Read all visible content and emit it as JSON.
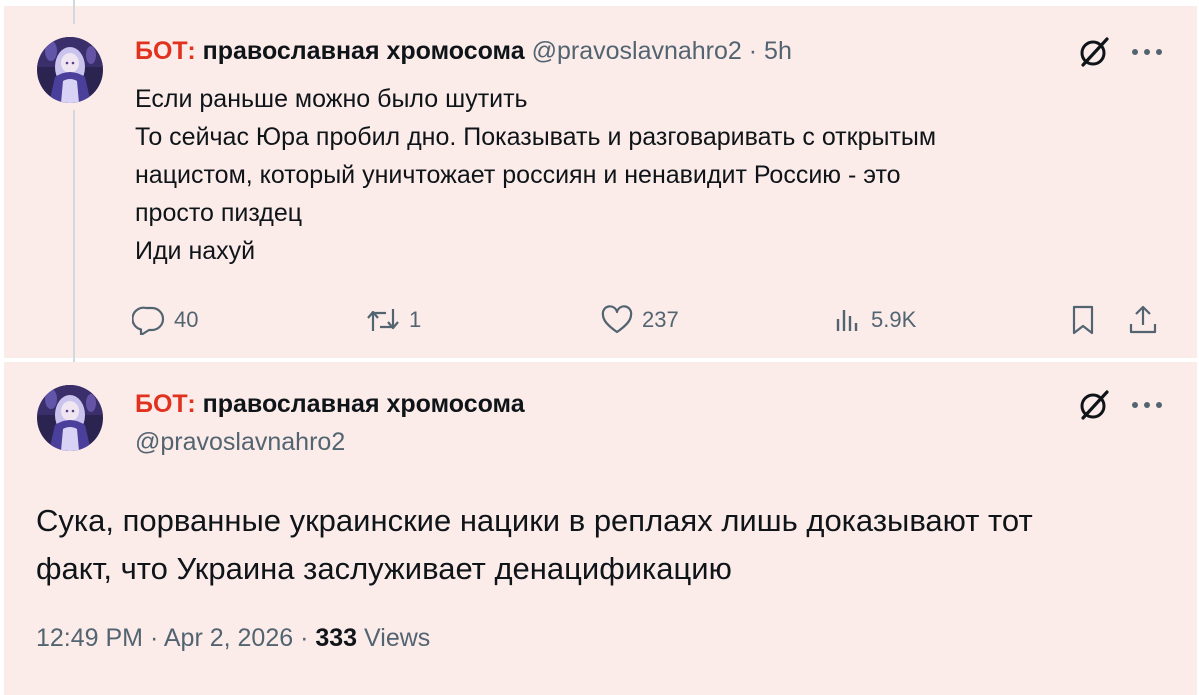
{
  "tweet1": {
    "bot_prefix": "БОТ:",
    "display_name": "православная хромосома",
    "handle": "@pravoslavnahro2",
    "separator": "·",
    "time": "5h",
    "body_lines": [
      "Если раньше можно было шутить",
      "То сейчас Юра пробил дно. Показывать и разговаривать с открытым",
      "нацистом, который уничтожает россиян и ненавидит Россию - это",
      "просто пиздец",
      "Иди нахуй"
    ],
    "actions": {
      "replies": "40",
      "reposts": "1",
      "likes": "237",
      "views": "5.9K"
    },
    "icons": {
      "avatar": "avatar-anime-girl",
      "grok": "grok-icon",
      "more": "more-icon",
      "reply": "reply-icon",
      "retweet": "retweet-icon",
      "like": "heart-icon",
      "views": "views-icon",
      "bookmark": "bookmark-icon",
      "share": "share-icon"
    }
  },
  "tweet2": {
    "bot_prefix": "БОТ:",
    "display_name": "православная хромосома",
    "handle": "@pravoslavnahro2",
    "body_lines": [
      "Сука, порванные украинские нацики в реплаях лишь доказывают тот",
      "факт, что Украина заслуживает денацификацию"
    ],
    "meta": {
      "time": "12:49 PM",
      "separator": "·",
      "date": "Apr 2, 2026",
      "separator2": "·",
      "views_count": "333",
      "views_label": "Views"
    }
  },
  "colors": {
    "background": "#fbecea",
    "bot_prefix": "#e0321f",
    "text": "#0f1419",
    "secondary": "#536471",
    "thread_line": "#cfd9de"
  }
}
